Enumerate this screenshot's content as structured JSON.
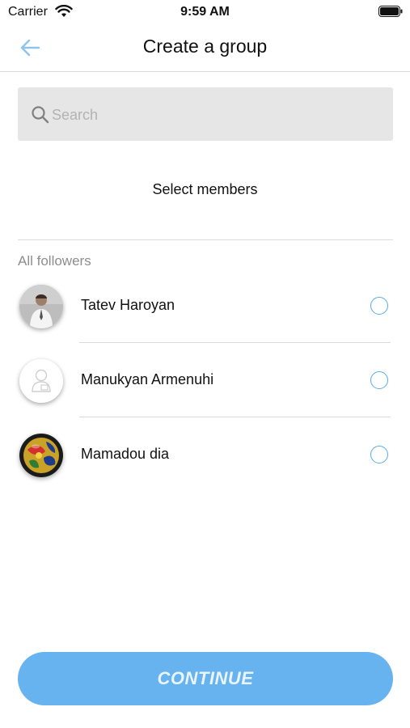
{
  "status_bar": {
    "carrier": "Carrier",
    "time": "9:59 AM"
  },
  "header": {
    "title": "Create a group",
    "back_icon": "arrow-left-icon"
  },
  "search": {
    "placeholder": "Search",
    "value": ""
  },
  "select_members_label": "Select members",
  "section": {
    "label": "All followers"
  },
  "members": [
    {
      "name": "Tatev Haroyan",
      "avatar": "photo",
      "selected": false
    },
    {
      "name": "Manukyan Armenuhi",
      "avatar": "placeholder-person",
      "selected": false
    },
    {
      "name": "Mamadou dia",
      "avatar": "colorful-ball",
      "selected": false
    }
  ],
  "continue_label": "CONTINUE",
  "colors": {
    "accent": "#5aa9e6",
    "button": "#66b3f0",
    "search_bg": "#e6e6e6"
  }
}
